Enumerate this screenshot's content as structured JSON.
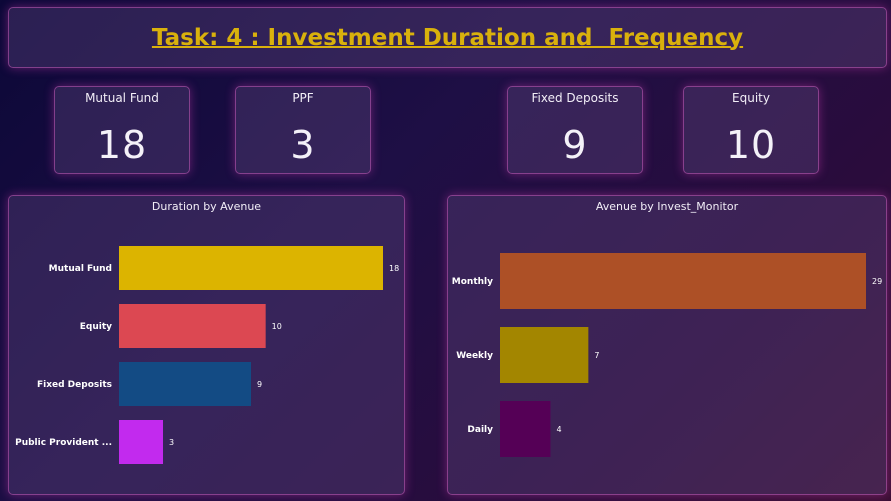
{
  "header": {
    "title": "Task: 4 : Investment Duration and  Frequency"
  },
  "cards": [
    {
      "label": "Mutual Fund",
      "value": "18"
    },
    {
      "label": "PPF",
      "value": "3"
    },
    {
      "label": "Fixed Deposits",
      "value": "9"
    },
    {
      "label": "Equity",
      "value": "10"
    }
  ],
  "chart_data": [
    {
      "type": "bar",
      "orientation": "horizontal",
      "title": "Duration by Avenue",
      "categories": [
        "Mutual Fund",
        "Equity",
        "Fixed Deposits",
        "Public Provident ..."
      ],
      "values": [
        18,
        10,
        9,
        3
      ],
      "colors": [
        "#dcb400",
        "#dc4852",
        "#134b84",
        "#c22aee"
      ],
      "xlabel": "",
      "ylabel": "",
      "xlim": [
        0,
        18
      ],
      "grid": false,
      "legend": "none"
    },
    {
      "type": "bar",
      "orientation": "horizontal",
      "title": "Avenue by Invest_Monitor",
      "categories": [
        "Monthly",
        "Weekly",
        "Daily"
      ],
      "values": [
        29,
        7,
        4
      ],
      "colors": [
        "#ad5026",
        "#a38600",
        "#550056"
      ],
      "xlabel": "",
      "ylabel": "",
      "xlim": [
        0,
        29
      ],
      "grid": false,
      "legend": "none"
    }
  ]
}
